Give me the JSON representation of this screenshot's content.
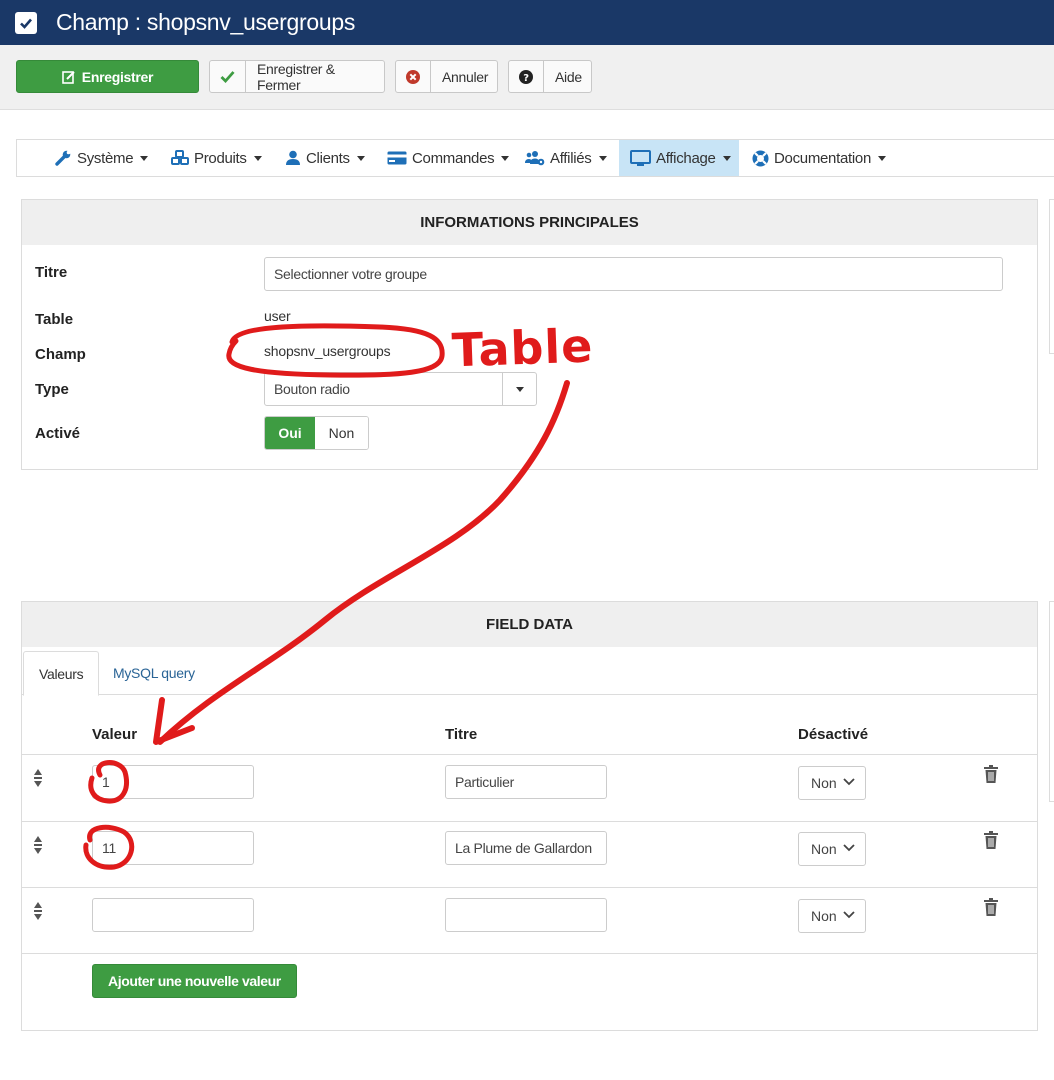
{
  "header": {
    "title": "Champ : shopsnv_usergroups"
  },
  "toolbar": {
    "save_label": "Enregistrer",
    "save_close_label": "Enregistrer & Fermer",
    "cancel_label": "Annuler",
    "help_label": "Aide"
  },
  "menu": {
    "items": [
      {
        "label": "Système"
      },
      {
        "label": "Produits"
      },
      {
        "label": "Clients"
      },
      {
        "label": "Commandes"
      },
      {
        "label": "Affiliés"
      },
      {
        "label": "Affichage",
        "active": true
      },
      {
        "label": "Documentation"
      }
    ]
  },
  "main_info": {
    "heading": "INFORMATIONS PRINCIPALES",
    "titre_label": "Titre",
    "titre_value": "Selectionner votre groupe",
    "table_label": "Table",
    "table_value": "user",
    "champ_label": "Champ",
    "champ_value": "shopsnv_usergroups",
    "type_label": "Type",
    "type_value": "Bouton radio",
    "active_label": "Activé",
    "toggle_on": "Oui",
    "toggle_off": "Non"
  },
  "field_data": {
    "heading": "FIELD DATA",
    "tabs": [
      {
        "label": "Valeurs",
        "active": true
      },
      {
        "label": "MySQL query"
      }
    ],
    "columns": {
      "value": "Valeur",
      "title": "Titre",
      "disabled": "Désactivé"
    },
    "rows": [
      {
        "value": "1",
        "title": "Particulier",
        "disabled": "Non"
      },
      {
        "value": "11",
        "title": "La Plume de Gallardon",
        "disabled": "Non"
      },
      {
        "value": "",
        "title": "",
        "disabled": "Non"
      }
    ],
    "add_button": "Ajouter une nouvelle valeur"
  },
  "annotation": {
    "text": "Table",
    "color": "#e01b1b"
  },
  "colors": {
    "header_bg": "#1a3867",
    "green": "#3e9c42",
    "active_menu": "#c8e4f6"
  }
}
